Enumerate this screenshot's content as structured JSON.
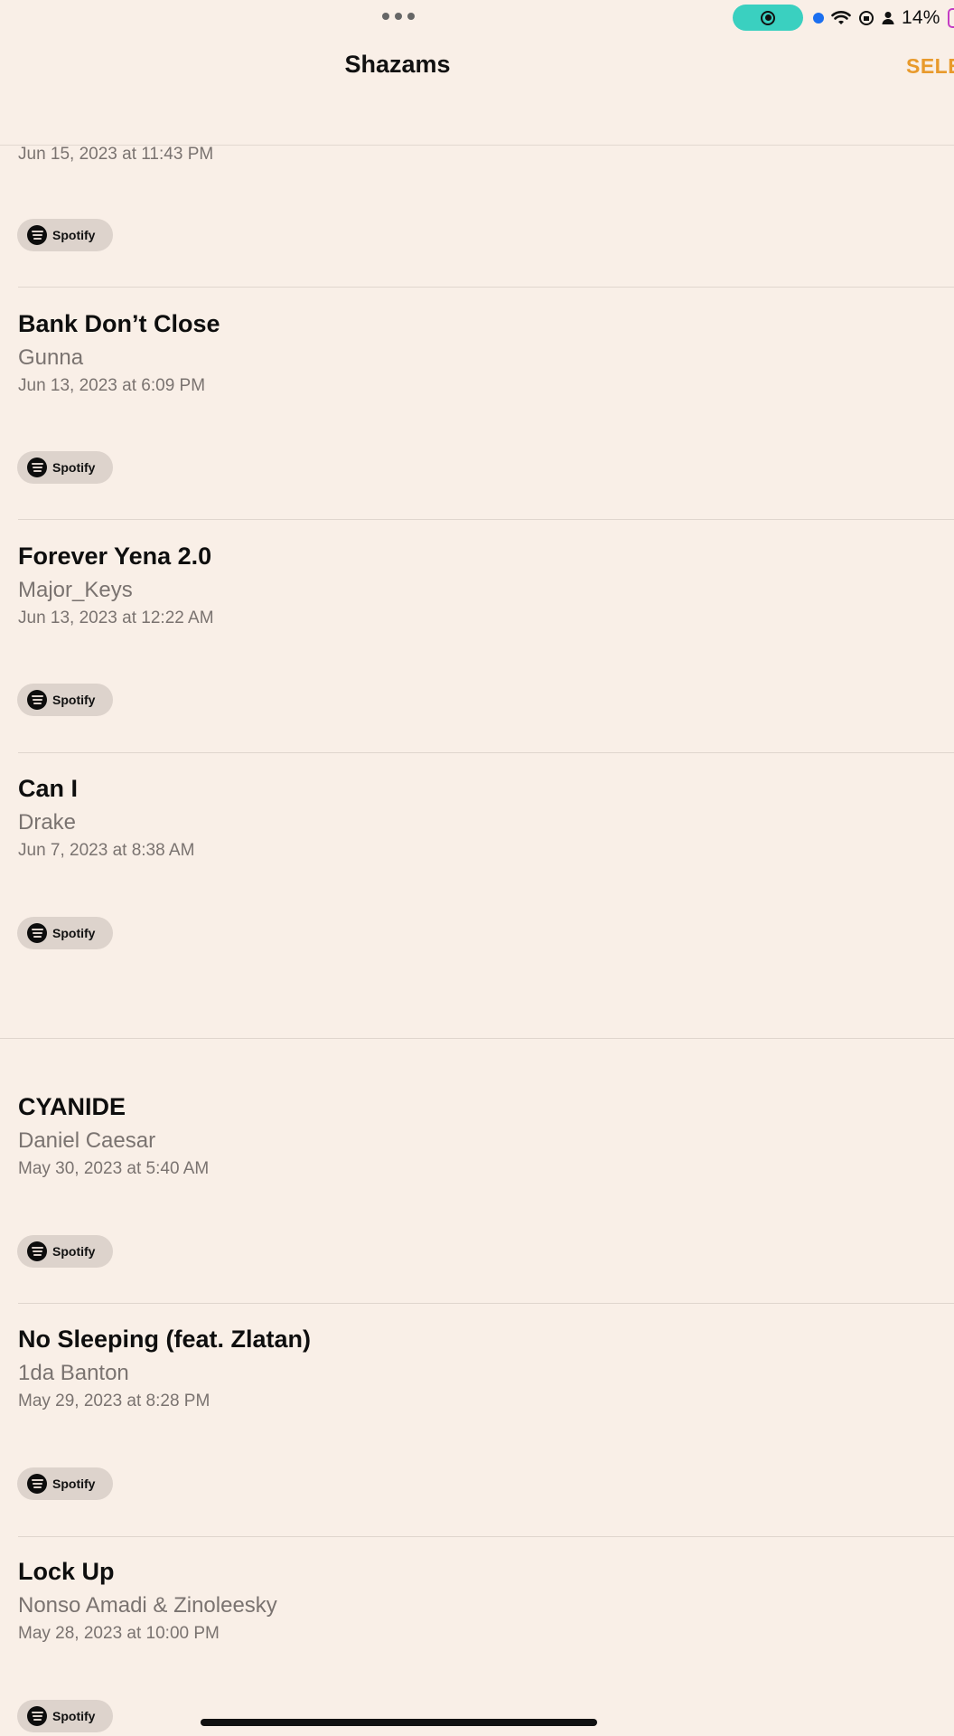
{
  "status": {
    "battery_percent": "14%"
  },
  "header": {
    "title": "Shazams",
    "select_label": "SELE"
  },
  "top_item": {
    "date": "Jun 15, 2023 at 11:43 PM",
    "service": "Spotify"
  },
  "items": [
    {
      "title": "Bank Don’t Close",
      "artist": "Gunna",
      "date": "Jun 13, 2023 at 6:09 PM",
      "service": "Spotify"
    },
    {
      "title": "Forever Yena 2.0",
      "artist": "Major_Keys",
      "date": "Jun 13, 2023 at 12:22 AM",
      "service": "Spotify"
    },
    {
      "title": "Can I",
      "artist": "Drake",
      "date": "Jun 7, 2023 at 8:38 AM",
      "service": "Spotify"
    },
    {
      "title": "CYANIDE",
      "artist": "Daniel Caesar",
      "date": "May 30, 2023 at 5:40 AM",
      "service": "Spotify"
    },
    {
      "title": "No Sleeping (feat. Zlatan)",
      "artist": "1da Banton",
      "date": "May 29, 2023 at 8:28 PM",
      "service": "Spotify"
    },
    {
      "title": "Lock Up",
      "artist": "Nonso Amadi & Zinoleesky",
      "date": "May 28, 2023 at 10:00 PM",
      "service": "Spotify"
    }
  ]
}
